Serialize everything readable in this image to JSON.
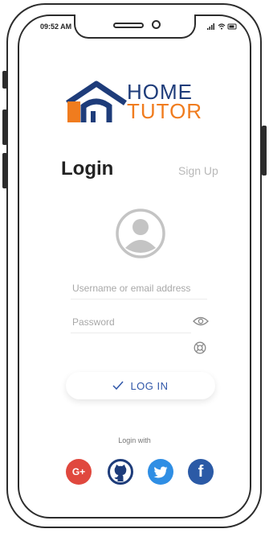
{
  "status": {
    "time": "09:52 AM",
    "icons": "..ıl ᯤ ▭"
  },
  "logo": {
    "line1": "HOME",
    "line2": "TUTOR"
  },
  "login": {
    "title": "Login",
    "signup": "Sign Up"
  },
  "form": {
    "username_placeholder": "Username or email address",
    "password_placeholder": "Password",
    "login_button": "LOG IN"
  },
  "social": {
    "caption": "Login with",
    "google_label": "G+",
    "facebook_label": "f"
  },
  "icons": {
    "avatar": "user-avatar-icon",
    "eye": "eye-icon",
    "help": "lifebuoy-icon",
    "check": "check-icon",
    "github": "github-icon",
    "twitter": "twitter-bird-icon"
  },
  "colors": {
    "brand_blue": "#1e3c7a",
    "brand_orange": "#f07c1e",
    "button_text": "#2f56a8",
    "google": "#e0483e",
    "twitter": "#2f8ee4",
    "facebook": "#2b5aa6"
  }
}
